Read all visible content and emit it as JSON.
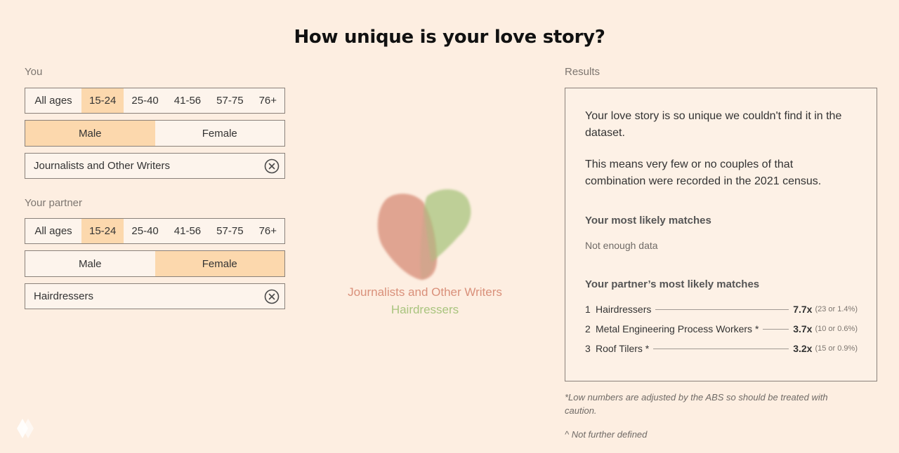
{
  "title": "How unique is your love story?",
  "you": {
    "label": "You",
    "ages": [
      "All ages",
      "15-24",
      "25-40",
      "41-56",
      "57-75",
      "76+"
    ],
    "selected_age": "15-24",
    "genders": [
      "Male",
      "Female"
    ],
    "selected_gender": "Male",
    "occupation": "Journalists and Other Writers"
  },
  "partner": {
    "label": "Your partner",
    "ages": [
      "All ages",
      "15-24",
      "25-40",
      "41-56",
      "57-75",
      "76+"
    ],
    "selected_age": "15-24",
    "genders": [
      "Male",
      "Female"
    ],
    "selected_gender": "Female",
    "occupation": "Hairdressers"
  },
  "visual": {
    "you_occupation": "Journalists and Other Writers",
    "partner_occupation": "Hairdressers",
    "you_color": "#d9907a",
    "partner_color": "#a9c47e"
  },
  "results": {
    "label": "Results",
    "para1": "Your love story is so unique we couldn't find it in the dataset.",
    "para2": "This means very few or no couples of that combination were recorded in the 2021 census.",
    "your_matches_heading": "Your most likely matches",
    "your_matches_note": "Not enough data",
    "partner_matches_heading": "Your partner’s most likely matches",
    "partner_matches": [
      {
        "rank": "1",
        "name": "Hairdressers",
        "multiplier": "7.7x",
        "detail": "(23 or 1.4%)"
      },
      {
        "rank": "2",
        "name": "Metal Engineering Process Workers *",
        "multiplier": "3.7x",
        "detail": "(10 or 0.6%)"
      },
      {
        "rank": "3",
        "name": "Roof Tilers *",
        "multiplier": "3.2x",
        "detail": "(15 or 0.9%)"
      }
    ]
  },
  "footnotes": {
    "asterisk": "*Low numbers are adjusted by the ABS so should be treated with caution.",
    "caret": "^ Not further defined"
  },
  "colors": {
    "background": "#fdeee1",
    "selected": "#fcd8ad",
    "border": "#8a817a"
  }
}
